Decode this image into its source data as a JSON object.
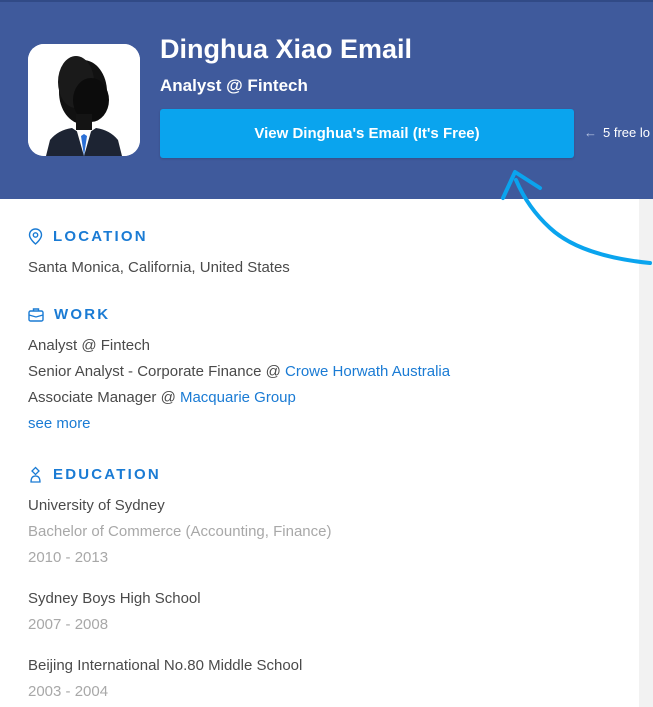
{
  "header": {
    "name": "Dinghua Xiao Email",
    "subtitle": "Analyst @ Fintech",
    "cta_label": "View Dinghua's Email (It's Free)",
    "free_note": "5 free lo"
  },
  "location": {
    "title": "LOCATION",
    "value": "Santa Monica, California, United States"
  },
  "work": {
    "title": "WORK",
    "current": "Analyst @ Fintech",
    "items": [
      {
        "role": "Senior Analyst - Corporate Finance @ ",
        "company": "Crowe Horwath Australia"
      },
      {
        "role": "Associate Manager @ ",
        "company": "Macquarie Group"
      }
    ],
    "see_more": "see more"
  },
  "education": {
    "title": "EDUCATION",
    "schools": [
      {
        "name": "University of Sydney",
        "degree": "Bachelor of Commerce (Accounting, Finance)",
        "years": "2010 - 2013"
      },
      {
        "name": "Sydney Boys High School",
        "years": "2007 - 2008"
      },
      {
        "name": "Beijing International No.80 Middle School",
        "years": "2003 - 2004"
      }
    ]
  },
  "colors": {
    "header_bg": "#3f5a9c",
    "cta_bg": "#0aa4ee",
    "accent": "#1a7bd4"
  }
}
